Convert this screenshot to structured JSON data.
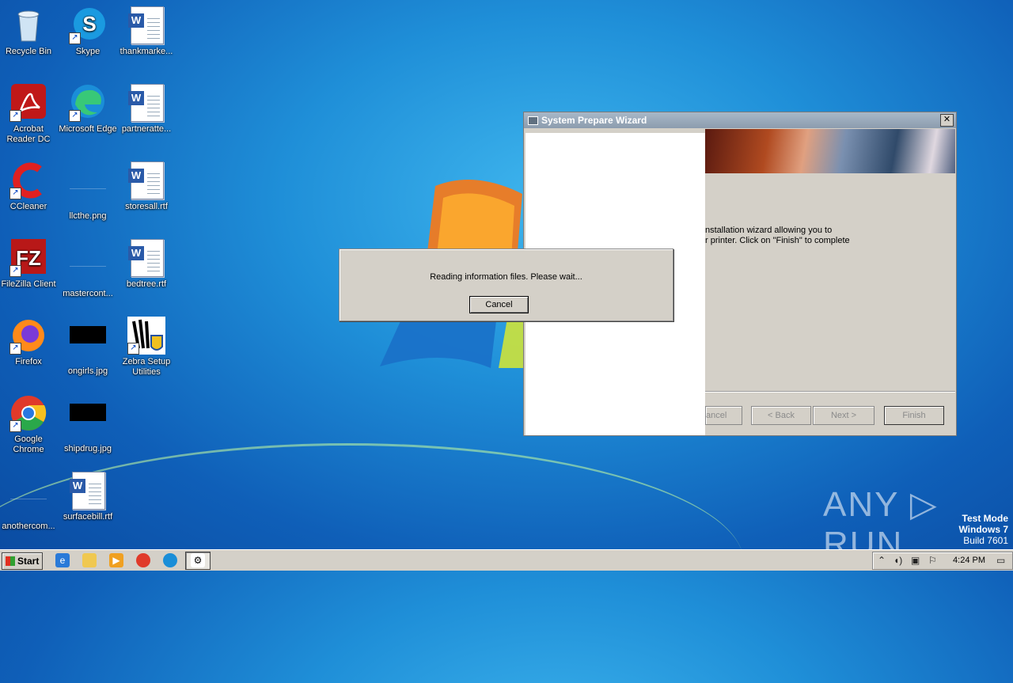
{
  "desktop": {
    "icons": [
      {
        "label": "Recycle Bin"
      },
      {
        "label": "Skype"
      },
      {
        "label": "thankmarke..."
      },
      {
        "label": "Acrobat Reader DC"
      },
      {
        "label": "Microsoft Edge"
      },
      {
        "label": "partneratte..."
      },
      {
        "label": "CCleaner"
      },
      {
        "label": "llcthe.png"
      },
      {
        "label": "storesall.rtf"
      },
      {
        "label": "FileZilla Client"
      },
      {
        "label": "mastercont..."
      },
      {
        "label": "bedtree.rtf"
      },
      {
        "label": "Firefox"
      },
      {
        "label": "ongirls.jpg"
      },
      {
        "label": "Zebra Setup Utilities"
      },
      {
        "label": "Google Chrome"
      },
      {
        "label": "shipdrug.jpg"
      },
      {
        "label": "anothercom..."
      },
      {
        "label": "surfacebill.rtf"
      }
    ]
  },
  "wizard": {
    "title": "System Prepare Wizard",
    "close_glyph": "✕",
    "body_line1": "nstallation wizard allowing you to",
    "body_line2": "r printer. Click on \"Finish\" to complete",
    "buttons": {
      "cancel": "ancel",
      "back": "< Back",
      "next": "Next >",
      "finish": "Finish"
    }
  },
  "dialog": {
    "message": "Reading information files. Please wait...",
    "cancel_label": "Cancel"
  },
  "watermark": {
    "anyrun": "ANY ▷ RUN",
    "test_mode": "Test Mode",
    "os": "Windows 7",
    "build": "Build 7601"
  },
  "taskbar": {
    "start_label": "Start",
    "clock": "4:24 PM"
  }
}
